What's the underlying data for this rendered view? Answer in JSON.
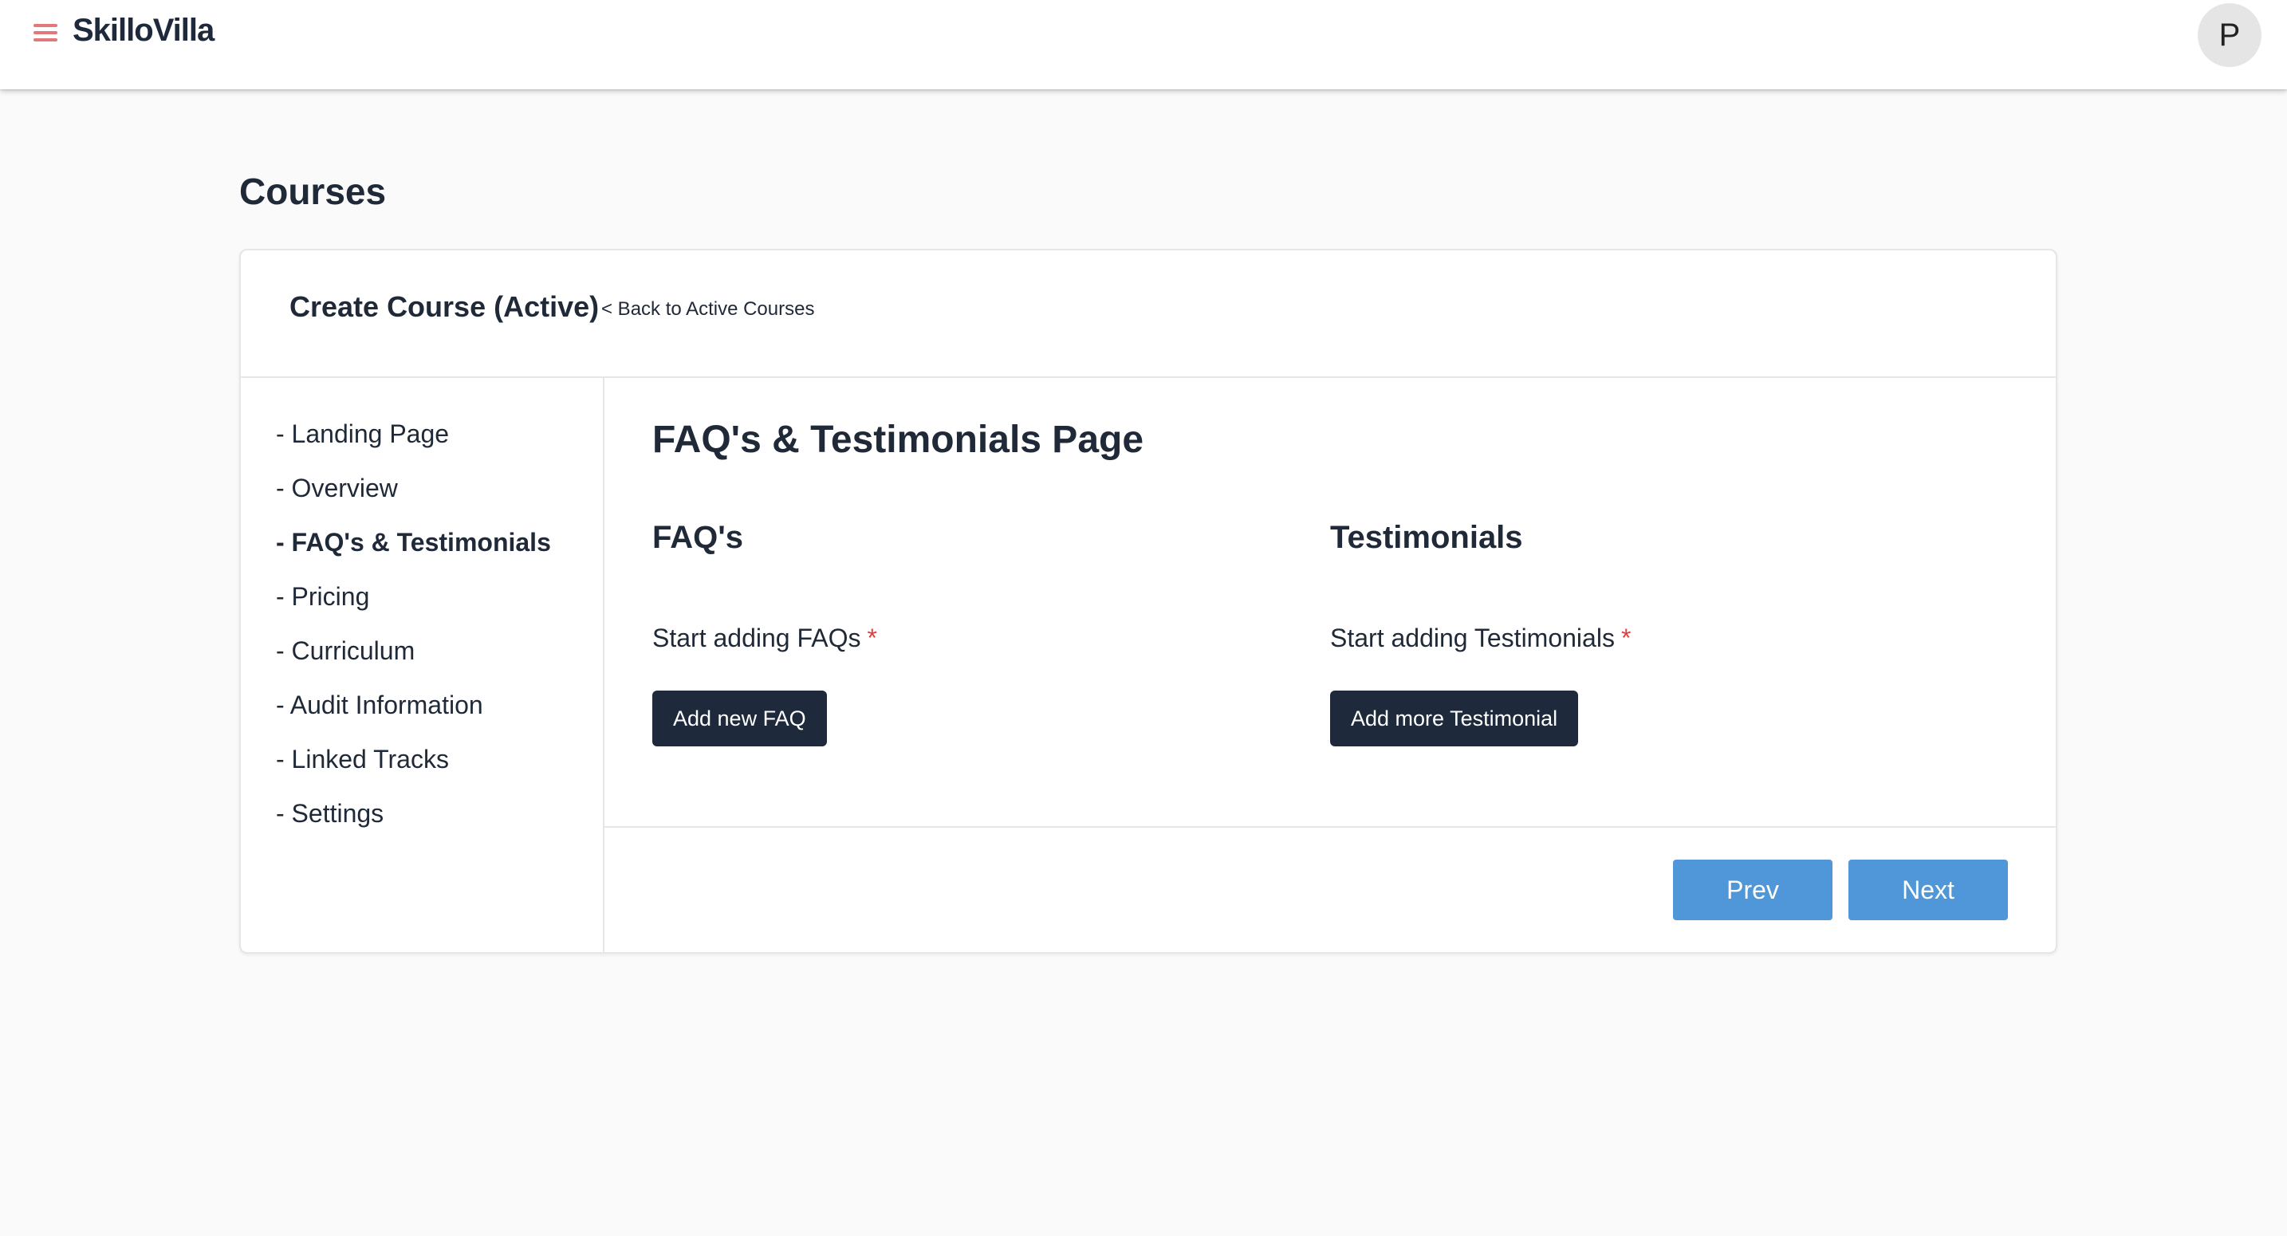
{
  "app": {
    "brand": "SkilloVilla",
    "menu_icon": "hamburger-menu-icon",
    "avatar_initial": "P"
  },
  "page": {
    "title": "Courses"
  },
  "card": {
    "title": "Create Course (Active)",
    "back_link": "< Back to Active Courses"
  },
  "sidebar": {
    "items": [
      {
        "label": "- Landing Page",
        "active": false
      },
      {
        "label": "- Overview",
        "active": false
      },
      {
        "label": "- FAQ's & Testimonials",
        "active": true
      },
      {
        "label": "- Pricing",
        "active": false
      },
      {
        "label": "- Curriculum",
        "active": false
      },
      {
        "label": "- Audit Information",
        "active": false
      },
      {
        "label": "- Linked Tracks",
        "active": false
      },
      {
        "label": "- Settings",
        "active": false
      }
    ]
  },
  "main": {
    "section_title": "FAQ's & Testimonials Page",
    "faqs": {
      "title": "FAQ's",
      "field_label": "Start adding FAQs",
      "required_mark": "*",
      "button_label": "Add new FAQ"
    },
    "testimonials": {
      "title": "Testimonials",
      "field_label": "Start adding Testimonials",
      "required_mark": "*",
      "button_label": "Add more Testimonial"
    },
    "prev_label": "Prev",
    "next_label": "Next"
  },
  "colors": {
    "accent_blue": "#4f97d8",
    "dark_button": "#1e293b",
    "required_red": "#e53e3e",
    "menu_icon": "#e07a7a"
  }
}
